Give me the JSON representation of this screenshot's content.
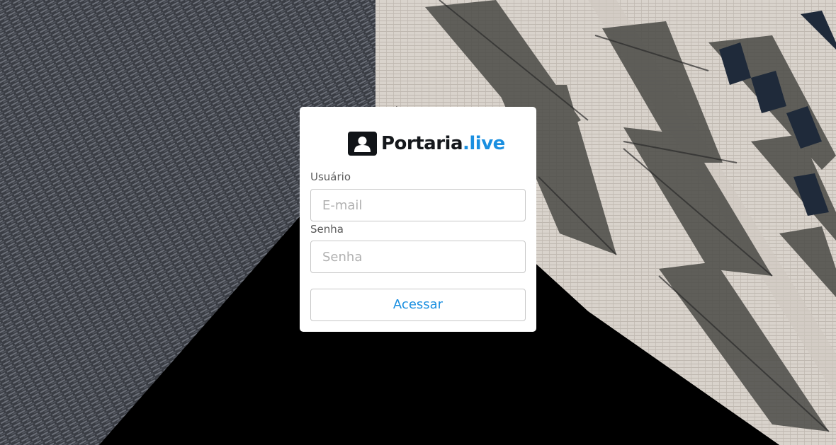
{
  "brand": {
    "name_main": "Portaria",
    "name_accent": ".live",
    "icon": "id-card-icon",
    "accent_color": "#1a8fe0"
  },
  "form": {
    "user_label": "Usuário",
    "user_placeholder": "E-mail",
    "password_label": "Senha",
    "password_placeholder": "Senha",
    "submit_label": "Acessar"
  }
}
